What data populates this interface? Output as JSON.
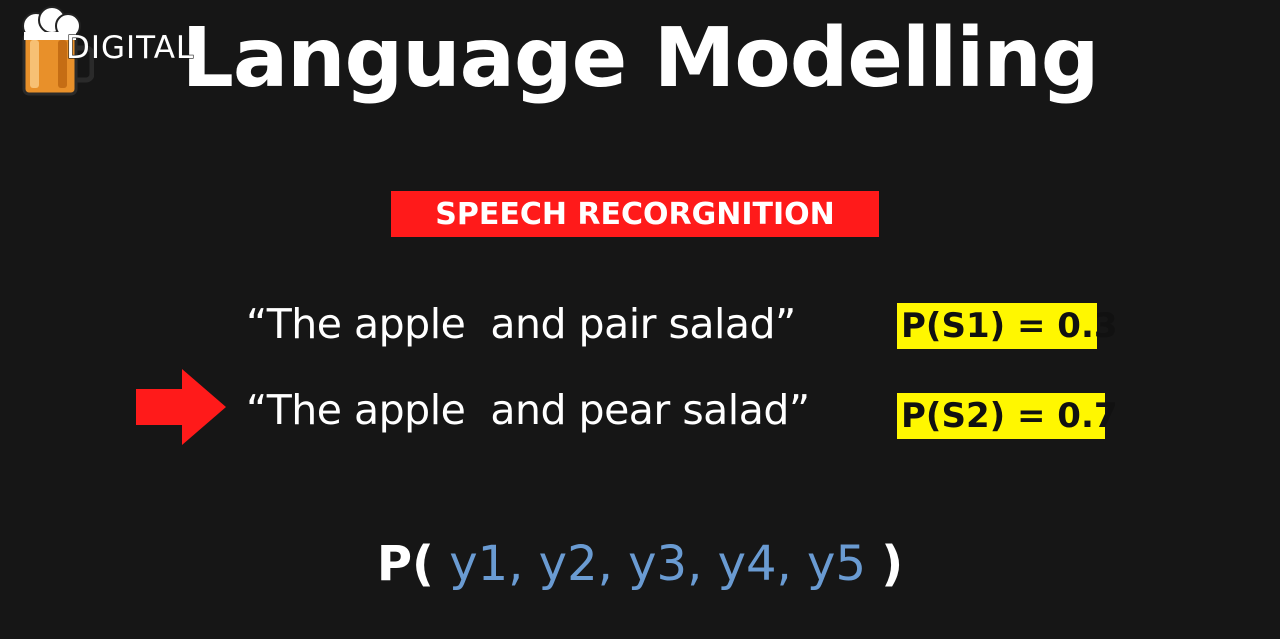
{
  "logo": {
    "text": "DIGITAL",
    "icon": "beer-mug-icon"
  },
  "title": "Language Modelling",
  "badge": {
    "text": "SPEECH RECORGNITION",
    "color": "#ff1a1a"
  },
  "sentences": [
    {
      "text": "“The apple  and pair salad”",
      "probability": "P(S1) = 0.3",
      "selected": false
    },
    {
      "text": "“The apple  and pear salad”",
      "probability": "P(S2) = 0.7",
      "selected": true
    }
  ],
  "pointer": {
    "icon": "right-arrow-icon",
    "color": "#ff1a1a"
  },
  "formula": {
    "prefix": "P(",
    "variables": " y1, y2, y3, y4, y5 ",
    "suffix": ")",
    "variable_color": "#6a9bd2"
  },
  "colors": {
    "background": "#161616",
    "highlight": "#fff700",
    "text": "#ffffff"
  }
}
